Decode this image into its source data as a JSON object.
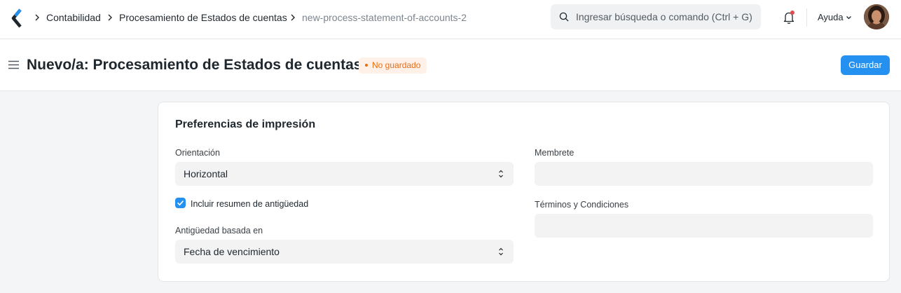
{
  "navbar": {
    "breadcrumbs": [
      "Contabilidad",
      "Procesamiento de Estados de cuentas",
      "new-process-statement-of-accounts-2"
    ],
    "search_placeholder": "Ingresar búsqueda o comando (Ctrl + G)",
    "help_label": "Ayuda"
  },
  "page": {
    "title": "Nuevo/a: Procesamiento de Estados de cuentas",
    "status_badge": "No guardado",
    "save_label": "Guardar"
  },
  "form": {
    "section_title": "Preferencias de impresión",
    "orientation_label": "Orientación",
    "orientation_value": "Horizontal",
    "include_ageing_label": "Incluir resumen de antigüedad",
    "include_ageing_checked": true,
    "ageing_based_on_label": "Antigüedad basada en",
    "ageing_based_on_value": "Fecha de vencimiento",
    "letterhead_label": "Membrete",
    "letterhead_value": "",
    "terms_label": "Términos y Condiciones",
    "terms_value": ""
  },
  "colors": {
    "primary": "#2490ef",
    "badge_text": "#e86c13",
    "badge_bg": "#fff1e7",
    "notification_dot": "#e24c4c"
  },
  "icons": [
    "app-logo-icon",
    "chevron-right-icon",
    "search-icon",
    "bell-icon",
    "chevron-down-icon",
    "hamburger-menu-icon",
    "select-arrows-icon",
    "check-icon"
  ]
}
